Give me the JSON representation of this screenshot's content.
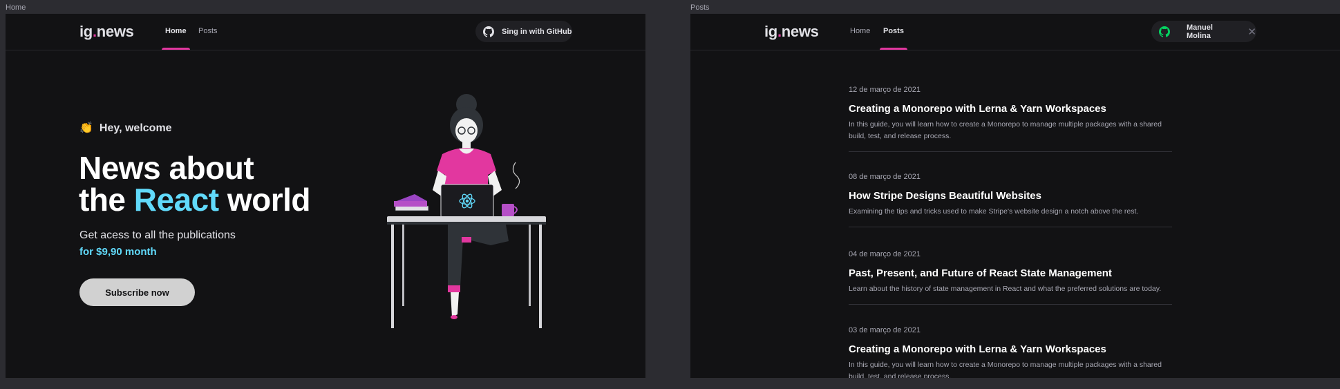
{
  "frames": {
    "home_label": "Home",
    "posts_label": "Posts"
  },
  "header": {
    "logo_main": "ig",
    "logo_dot": ".",
    "logo_tail": "news",
    "nav": {
      "home": "Home",
      "posts": "Posts"
    },
    "signin_label": "Sing in with GitHub",
    "signed_user": "Manuel Molina",
    "close_symbol": "✕"
  },
  "hero": {
    "welcome_emoji": "👏",
    "welcome": "Hey, welcome",
    "headline_line1": "News about",
    "headline_the": "the",
    "headline_react": "React",
    "headline_world": "world",
    "subtitle": "Get acess to all the publications",
    "price": "for $9,90 month",
    "subscribe_label": "Subscribe now"
  },
  "posts": [
    {
      "date": "12 de março de 2021",
      "title": "Creating a Monorepo with Lerna & Yarn Workspaces",
      "excerpt": "In this guide, you will learn how to create a Monorepo to manage multiple packages with a shared build, test, and release process."
    },
    {
      "date": "08 de março de 2021",
      "title": "How Stripe Designs Beautiful Websites",
      "excerpt": "Examining the tips and tricks used to make Stripe's website design a notch above the rest."
    },
    {
      "date": "04 de março de 2021",
      "title": "Past, Present, and Future of React State Management",
      "excerpt": "Learn about the history of state management in React and what the preferred solutions are today."
    },
    {
      "date": "03 de março de 2021",
      "title": "Creating a Monorepo with Lerna & Yarn Workspaces",
      "excerpt": "In this guide, you will learn how to create a Monorepo to manage multiple packages with a shared build, test, and release process."
    }
  ],
  "colors": {
    "background": "#121214",
    "accent_pink": "#e2379f",
    "react_cyan": "#61dafb",
    "github_green": "#04d361",
    "text": "#e1e1e6",
    "muted": "#a8a8b3"
  },
  "icons": {
    "github": "github-icon",
    "close": "close-icon",
    "clap": "clapping-hands-icon",
    "react": "react-logo-icon"
  }
}
